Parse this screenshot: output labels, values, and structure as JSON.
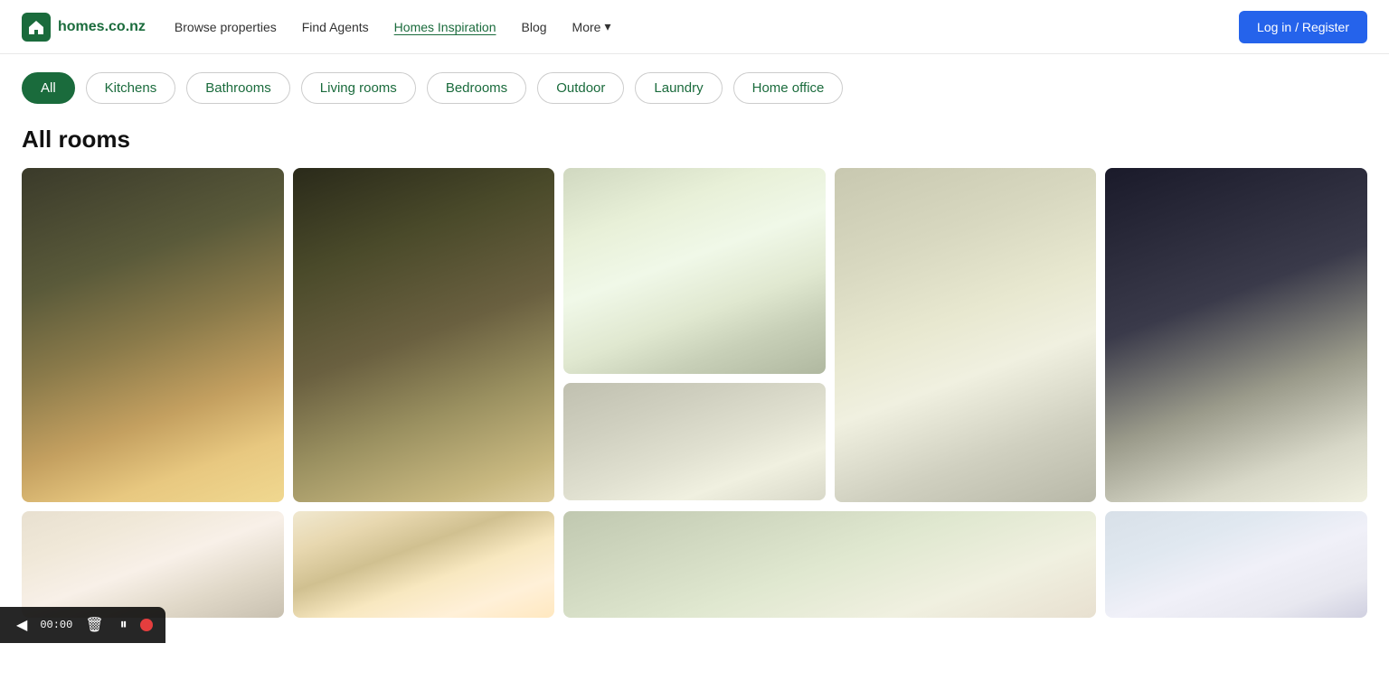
{
  "header": {
    "logo_text": "homes.co.nz",
    "nav": [
      {
        "id": "browse",
        "label": "Browse properties",
        "active": false
      },
      {
        "id": "agents",
        "label": "Find Agents",
        "active": false
      },
      {
        "id": "inspiration",
        "label": "Homes Inspiration",
        "active": true
      },
      {
        "id": "blog",
        "label": "Blog",
        "active": false
      },
      {
        "id": "more",
        "label": "More",
        "active": false,
        "has_chevron": true
      }
    ],
    "login_label": "Log in / Register"
  },
  "filters": {
    "chips": [
      {
        "id": "all",
        "label": "All",
        "active": true
      },
      {
        "id": "kitchens",
        "label": "Kitchens",
        "active": false
      },
      {
        "id": "bathrooms",
        "label": "Bathrooms",
        "active": false
      },
      {
        "id": "living",
        "label": "Living rooms",
        "active": false
      },
      {
        "id": "bedrooms",
        "label": "Bedrooms",
        "active": false
      },
      {
        "id": "outdoor",
        "label": "Outdoor",
        "active": false
      },
      {
        "id": "laundry",
        "label": "Laundry",
        "active": false
      },
      {
        "id": "home_office",
        "label": "Home office",
        "active": false
      }
    ]
  },
  "section_title": "All rooms",
  "media_toolbar": {
    "time": "00:00",
    "back_label": "◀",
    "delete_label": "🗑",
    "pause_label": "⏸"
  }
}
